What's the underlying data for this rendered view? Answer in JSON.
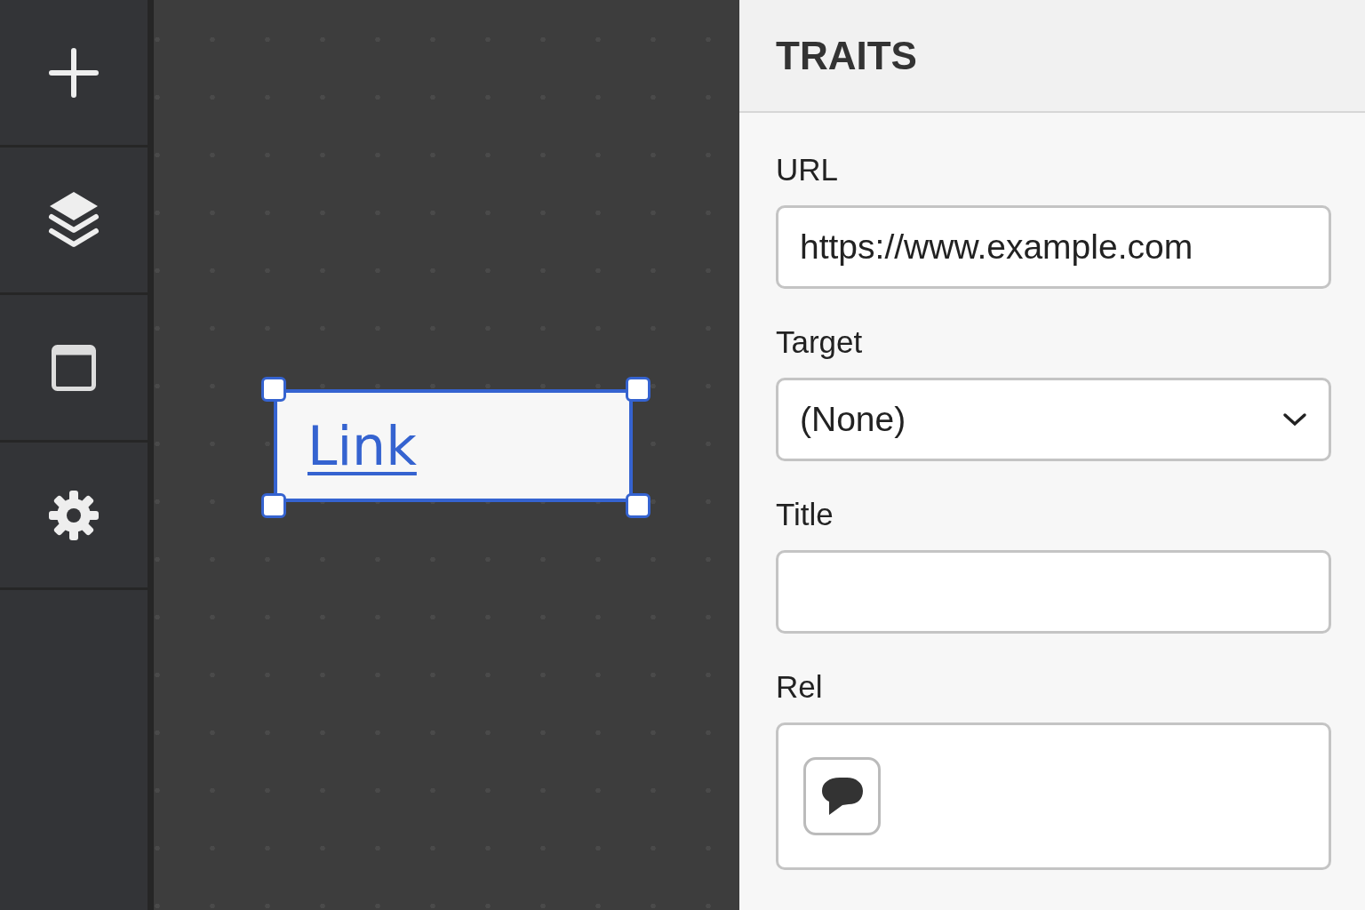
{
  "sidebar": {
    "items": [
      {
        "kind": "add"
      },
      {
        "kind": "layers"
      },
      {
        "kind": "window"
      },
      {
        "kind": "settings"
      }
    ]
  },
  "canvas": {
    "element": {
      "text": "Link",
      "selected": true
    }
  },
  "panel": {
    "title": "TRAITS",
    "fields": [
      {
        "kind": "text",
        "label": "URL",
        "value": "https://www.example.com"
      },
      {
        "kind": "select",
        "label": "Target",
        "value": "(None)"
      },
      {
        "kind": "text",
        "label": "Title"
      },
      {
        "kind": "icons",
        "label": "Rel"
      }
    ]
  }
}
